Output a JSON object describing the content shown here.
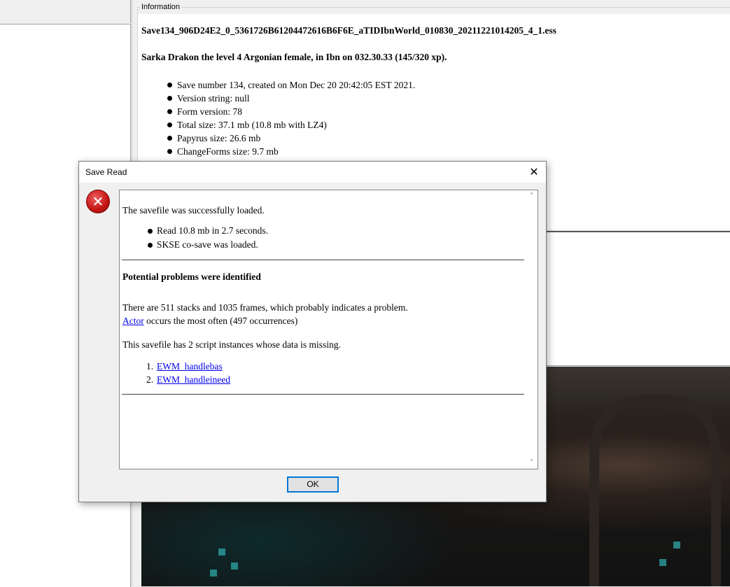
{
  "information": {
    "legend": "Information",
    "filename": "Save134_906D24E2_0_5361726B61204472616B6F6E_aTIDIbnWorld_010830_20211221014205_4_1.ess",
    "character": "Sarka Drakon the level 4 Argonian female, in Ibn on 032.30.33 (145/320 xp).",
    "details": [
      "Save number 134, created on Mon Dec 20 20:42:05 EST 2021.",
      "Version string: null",
      "Form version: 78",
      "Total size: 37.1 mb (10.8 mb with LZ4)",
      "Papyrus size: 26.6 mb",
      "ChangeForms size: 9.7 mb"
    ]
  },
  "dialog": {
    "title": "Save Read",
    "close_glyph": "✕",
    "icon": "error-icon",
    "error_glyph": "✕",
    "loaded_text": "The savefile was successfully loaded.",
    "load_details": [
      "Read 10.8 mb in 2.7 seconds.",
      "SKSE co-save was loaded."
    ],
    "problems_heading": "Potential problems were identified",
    "stacks_text": "There are 511 stacks and 1035 frames, which probably indicates a problem.",
    "actor_link": "Actor",
    "actor_suffix": " occurs the most often (497 occurrences)",
    "missing_text": "This savefile has 2 script instances whose data is missing.",
    "missing_scripts": [
      {
        "num": "1.",
        "name": "EWM_handlebas"
      },
      {
        "num": "2.",
        "name": "EWM_handleineed"
      }
    ],
    "ok_label": "OK",
    "scroll_up_glyph": "˄",
    "scroll_down_glyph": "˅"
  },
  "colors": {
    "link": "#0000ee",
    "error_red": "#c41414",
    "button_focus": "#0078d7"
  }
}
